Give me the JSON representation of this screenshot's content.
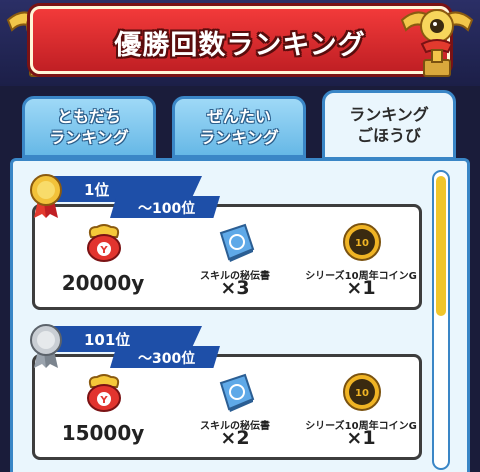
{
  "header": {
    "title": "優勝回数ランキング"
  },
  "tabs": [
    {
      "label": "ともだち\nランキング",
      "active": false
    },
    {
      "label": "ぜんたい\nランキング",
      "active": false
    },
    {
      "label": "ランキング\nごほうび",
      "active": true
    }
  ],
  "rewards": [
    {
      "rank": "1位",
      "range": "～100位",
      "medal": "gold-medal-icon",
      "items": [
        {
          "icon": "money-pouch-icon",
          "name": "",
          "amount": "20000y"
        },
        {
          "icon": "skill-book-icon",
          "name": "スキルの秘伝書",
          "amount": "×3"
        },
        {
          "icon": "anniversary-coin-icon",
          "name": "シリーズ10周年コインG",
          "amount": "×1"
        }
      ]
    },
    {
      "rank": "101位",
      "range": "～300位",
      "medal": "silver-medal-icon",
      "items": [
        {
          "icon": "money-pouch-icon",
          "name": "",
          "amount": "15000y"
        },
        {
          "icon": "skill-book-icon",
          "name": "スキルの秘伝書",
          "amount": "×2"
        },
        {
          "icon": "anniversary-coin-icon",
          "name": "シリーズ10周年コインG",
          "amount": "×1"
        }
      ]
    }
  ],
  "colors": {
    "banner": "#d62a2e",
    "tab": "#7cc4ee",
    "ribbon": "#1e4fa8",
    "scroll_thumb": "#f0c52b"
  }
}
